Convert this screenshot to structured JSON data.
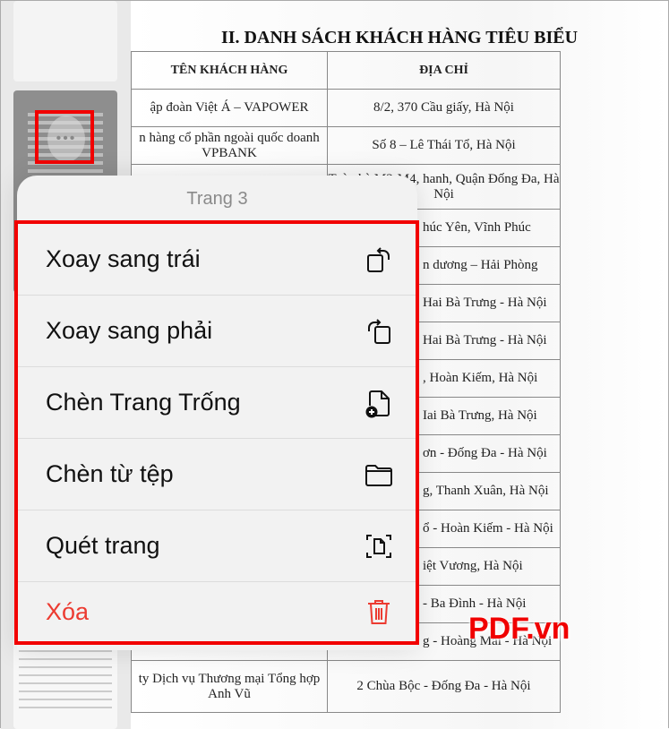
{
  "document": {
    "title": "II. DANH SÁCH KHÁCH HÀNG TIÊU BIỂU",
    "headers": [
      "TÊN KHÁCH HÀNG",
      "ĐỊA CHỈ"
    ],
    "rows": [
      [
        "ập đoàn Việt Á – VAPOWER",
        "8/2, 370 Cầu giấy, Hà Nội"
      ],
      [
        "n hàng cổ phần ngoài quốc doanh VPBANK",
        "Số 8 – Lê Thái Tổ, Hà Nội"
      ],
      [
        "",
        "Toà nhà M3-M4, hanh, Quận Đống Đa, Hà Nội"
      ],
      [
        "",
        "húc Yên, Vĩnh Phúc"
      ],
      [
        "",
        "n dương – Hải Phòng"
      ],
      [
        "",
        "Hai Bà Trưng - Hà Nội"
      ],
      [
        "",
        "Hai Bà Trưng - Hà Nội"
      ],
      [
        "",
        ", Hoàn Kiếm, Hà Nội"
      ],
      [
        "",
        "Iai Bà Trưng, Hà Nội"
      ],
      [
        "",
        "ơn - Đống Đa - Hà Nội"
      ],
      [
        "",
        "g, Thanh Xuân, Hà Nội"
      ],
      [
        "",
        "ổ - Hoàn Kiếm - Hà Nội"
      ],
      [
        "",
        "iệt Vương, Hà Nội"
      ],
      [
        "",
        "- Ba Đình - Hà Nội"
      ],
      [
        "",
        "g - Hoàng Mai - Hà Nội"
      ],
      [
        "ty Dịch vụ Thương mại Tổng hợp Anh Vũ",
        "2 Chùa Bộc - Đống Đa - Hà Nội"
      ]
    ]
  },
  "sheet": {
    "title": "Trang 3",
    "items": [
      {
        "label": "Xoay sang trái",
        "icon": "rotate-left-icon"
      },
      {
        "label": "Xoay sang phải",
        "icon": "rotate-right-icon"
      },
      {
        "label": "Chèn Trang Trống",
        "icon": "insert-blank-page-icon"
      },
      {
        "label": "Chèn từ tệp",
        "icon": "folder-icon"
      },
      {
        "label": "Quét trang",
        "icon": "scan-page-icon"
      },
      {
        "label": "Xóa",
        "icon": "trash-icon",
        "color": "#ec3b31"
      }
    ]
  },
  "highlight_color": "#f20000",
  "watermark": "PDF.vn"
}
